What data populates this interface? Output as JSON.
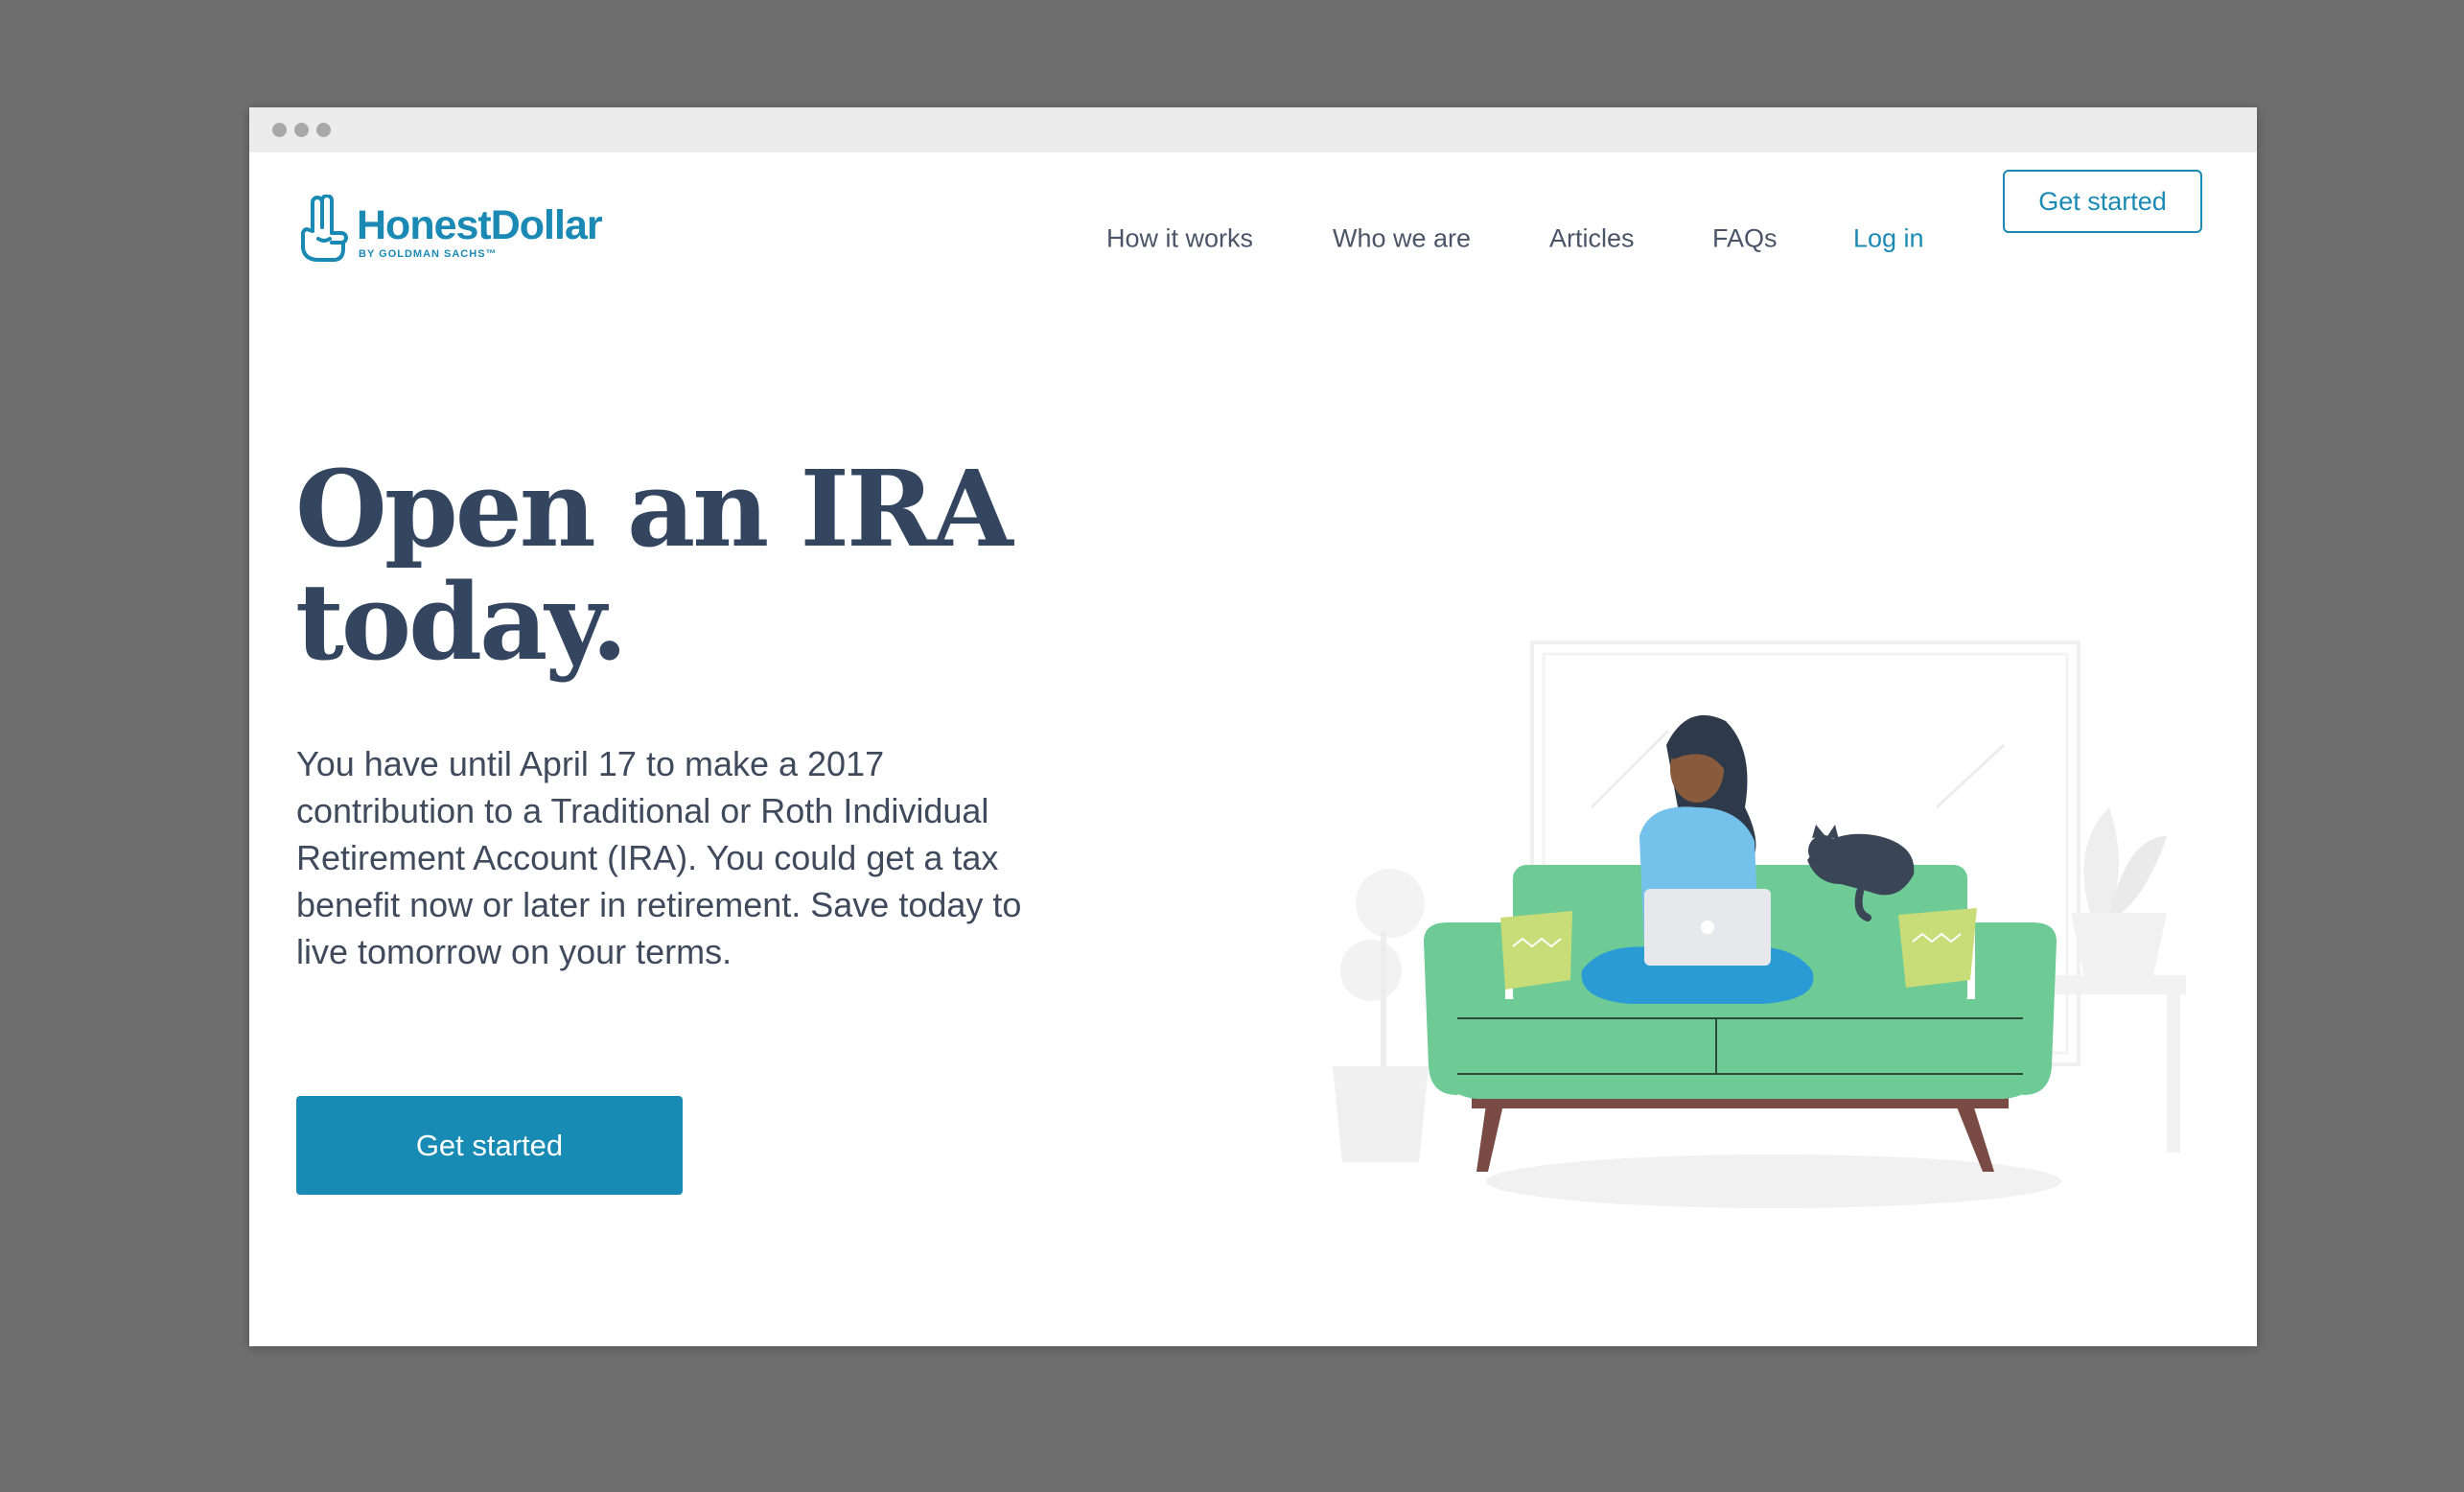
{
  "brand": {
    "name": "HonestDollar",
    "tagline": "BY GOLDMAN SACHS™",
    "color": "#1a8ab4"
  },
  "nav": {
    "links": [
      "How it works",
      "Who we are",
      "Articles",
      "FAQs"
    ],
    "login": "Log in",
    "cta": "Get started"
  },
  "hero": {
    "title_line1": "Open an IRA",
    "title_line2": "today.",
    "body": "You have until April 17 to make a 2017 contribution to a Traditional or Roth Individual Retirement Account (IRA). You could get a tax benefit now or later in retirement. Save today to live tomorrow on your terms.",
    "cta": "Get started"
  },
  "colors": {
    "title": "#344560",
    "button": "#178bb3",
    "sofa": "#6fcb95",
    "background": "#6e6e6e"
  },
  "icons": {
    "logo": "peace-hand-icon"
  }
}
